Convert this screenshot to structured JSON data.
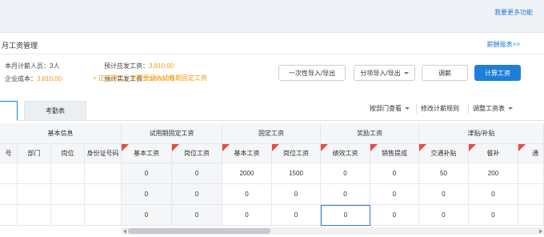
{
  "top": {
    "more_link": "我要更多功能"
  },
  "panel": {
    "title": "月工资管理",
    "report_link": "薪酬报表>>"
  },
  "summary": {
    "headcount_label": "本月计薪人员：",
    "headcount_value": "3人",
    "cost_label": "企业成本：",
    "cost_value": "3,810.00",
    "payable_label": "预计应发工资：",
    "payable_value": "3,810.00",
    "actual_label": "预计实发工资：",
    "actual_value": "3,800.70"
  },
  "buttons": {
    "import_once": "一次性导入/导出",
    "import_item": "分项导入/导出",
    "adjust": "调薪",
    "calculate": "计算工资"
  },
  "tabs": {
    "attendance": "考勤表"
  },
  "hint": "+ 正式员工，不需要录入试用期固定工资",
  "tools": {
    "by_dept": "按部门查看",
    "rules": "修改计薪规则",
    "adjust_table": "调整工资表"
  },
  "table": {
    "groups": [
      "基本信息",
      "试用期固定工资",
      "固定工资",
      "奖励工资",
      "津贴/补贴"
    ],
    "columns": [
      "号",
      "部门",
      "岗位",
      "身份证号码",
      "基本工资",
      "岗位工资",
      "基本工资",
      "岗位工资",
      "绩效工资",
      "销售提成",
      "交通补贴",
      "餐补",
      "通"
    ],
    "rows": [
      [
        "",
        "",
        "",
        "",
        "0",
        "0",
        "2000",
        "1500",
        "0",
        "0",
        "50",
        "200",
        ""
      ],
      [
        "",
        "",
        "",
        "",
        "0",
        "0",
        "0",
        "0",
        "0",
        "0",
        "0",
        "0",
        ""
      ],
      [
        "",
        "",
        "",
        "",
        "0",
        "0",
        "0",
        "0",
        "0",
        "0",
        "0",
        "0",
        ""
      ]
    ]
  },
  "colors": {
    "accent": "#1e7fd8",
    "orange": "#f39c12",
    "flag": "#e74c3c"
  }
}
